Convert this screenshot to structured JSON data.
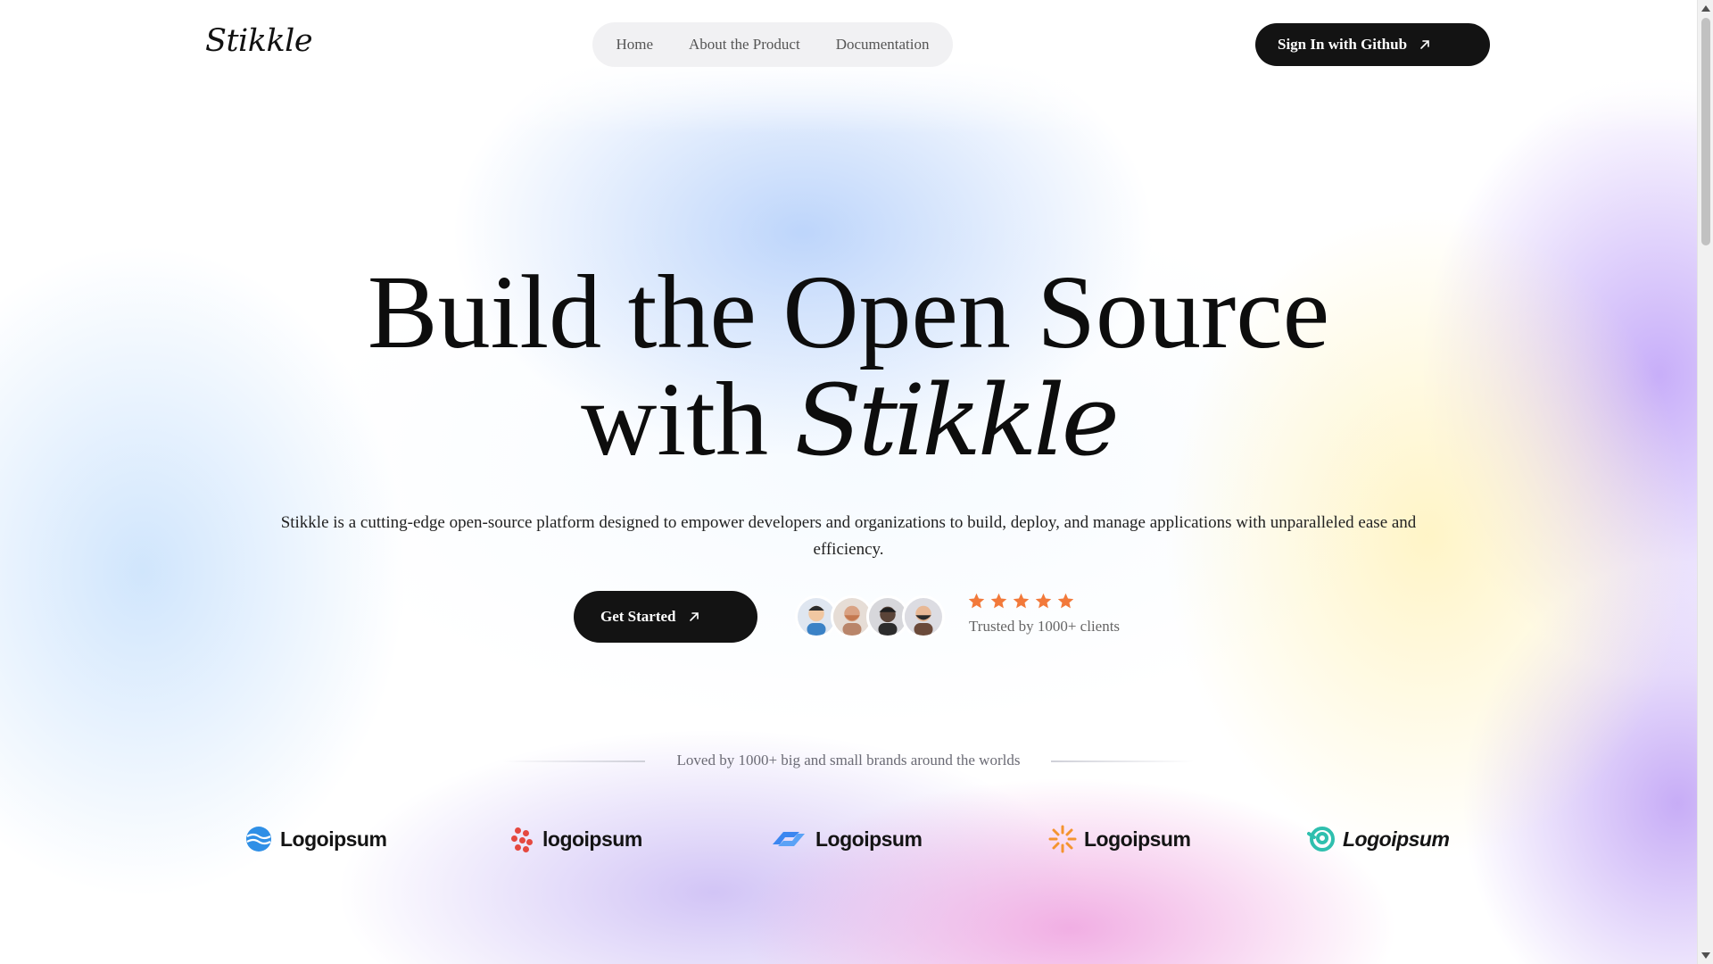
{
  "header": {
    "logo": "Stikkle",
    "nav": [
      {
        "label": "Home"
      },
      {
        "label": "About the Product"
      },
      {
        "label": "Documentation"
      }
    ],
    "signin_label": "Sign In with Github"
  },
  "hero": {
    "title_line1": "Build the Open Source",
    "title_line2_prefix": "with",
    "title_brand": "Stikkle",
    "description": "Stikkle is a cutting-edge open-source platform designed to empower developers and organizations to build, deploy, and manage applications with unparalleled ease and efficiency.",
    "cta_label": "Get Started",
    "rating": 5,
    "trusted_text": "Trusted by 1000+ clients",
    "star_color": "#f2793a"
  },
  "brands": {
    "caption": "Loved by 1000+ big and small brands around the worlds",
    "logos": [
      {
        "name": "Logoipsum",
        "icon": "wave-circle-icon",
        "color": "#2f8fe6"
      },
      {
        "name": "logoipsum",
        "icon": "dots-cluster-icon",
        "color": "#e5483f"
      },
      {
        "name": "Logoipsum",
        "icon": "swoosh-icon",
        "color": "#3c86f0"
      },
      {
        "name": "Logoipsum",
        "icon": "sunburst-icon",
        "color": "#f4942f"
      },
      {
        "name": "Logoipsum",
        "icon": "spiral-icon",
        "color": "#2fbfae"
      }
    ]
  }
}
